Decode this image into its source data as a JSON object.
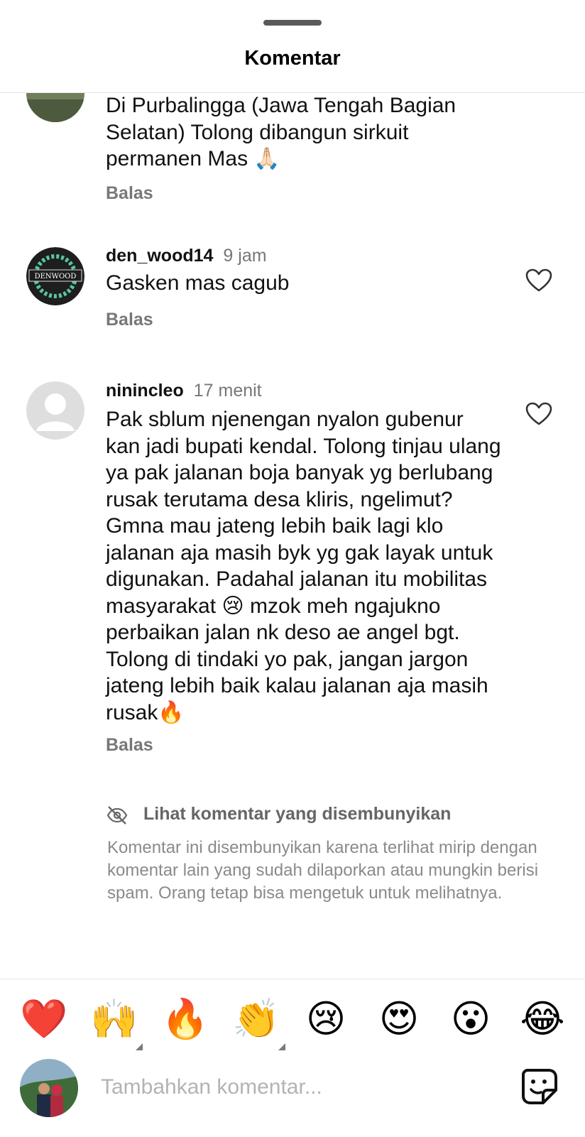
{
  "sheet": {
    "title": "Komentar"
  },
  "comments": [
    {
      "username": "",
      "time": "",
      "text": "Di Purbalingga (Jawa Tengah Bagian Selatan) Tolong dibangun sirkuit permanen Mas 🙏🏻",
      "reply": "Balas"
    },
    {
      "username": "den_wood14",
      "time": "9 jam",
      "text": "Gasken mas cagub",
      "reply": "Balas",
      "avatar_logo": "DENWOOD"
    },
    {
      "username": "ninincleo",
      "time": "17 menit",
      "text": "Pak sblum njenengan nyalon gubenur kan jadi bupati kendal. Tolong tinjau ulang ya pak jalanan boja banyak yg berlubang rusak terutama desa kliris, ngelimut? Gmna mau jateng lebih baik lagi klo jalanan aja masih byk yg gak layak untuk digunakan. Padahal jalanan itu mobilitas masyarakat 😢 mzok meh ngajukno perbaikan jalan nk deso ae angel bgt. Tolong di tindaki yo pak, jangan jargon jateng lebih baik kalau jalanan aja masih rusak🔥",
      "reply": "Balas"
    }
  ],
  "hidden": {
    "label": "Lihat komentar yang disembunyikan",
    "note": "Komentar ini disembunyikan karena terlihat mirip dengan komentar lain yang sudah dilaporkan atau mungkin berisi spam. Orang tetap bisa mengetuk untuk melihatnya.",
    "icon": "eye-off-icon"
  },
  "quick_emojis": [
    "❤️",
    "🙌",
    "🔥",
    "👏",
    "😢",
    "😍",
    "😮",
    "😂"
  ],
  "composer": {
    "placeholder": "Tambahkan komentar...",
    "sticker_icon": "sticker-icon"
  },
  "colors": {
    "text": "#111111",
    "secondary": "#777777",
    "placeholder": "#b3b3b3",
    "divider": "#e6e6e6"
  }
}
